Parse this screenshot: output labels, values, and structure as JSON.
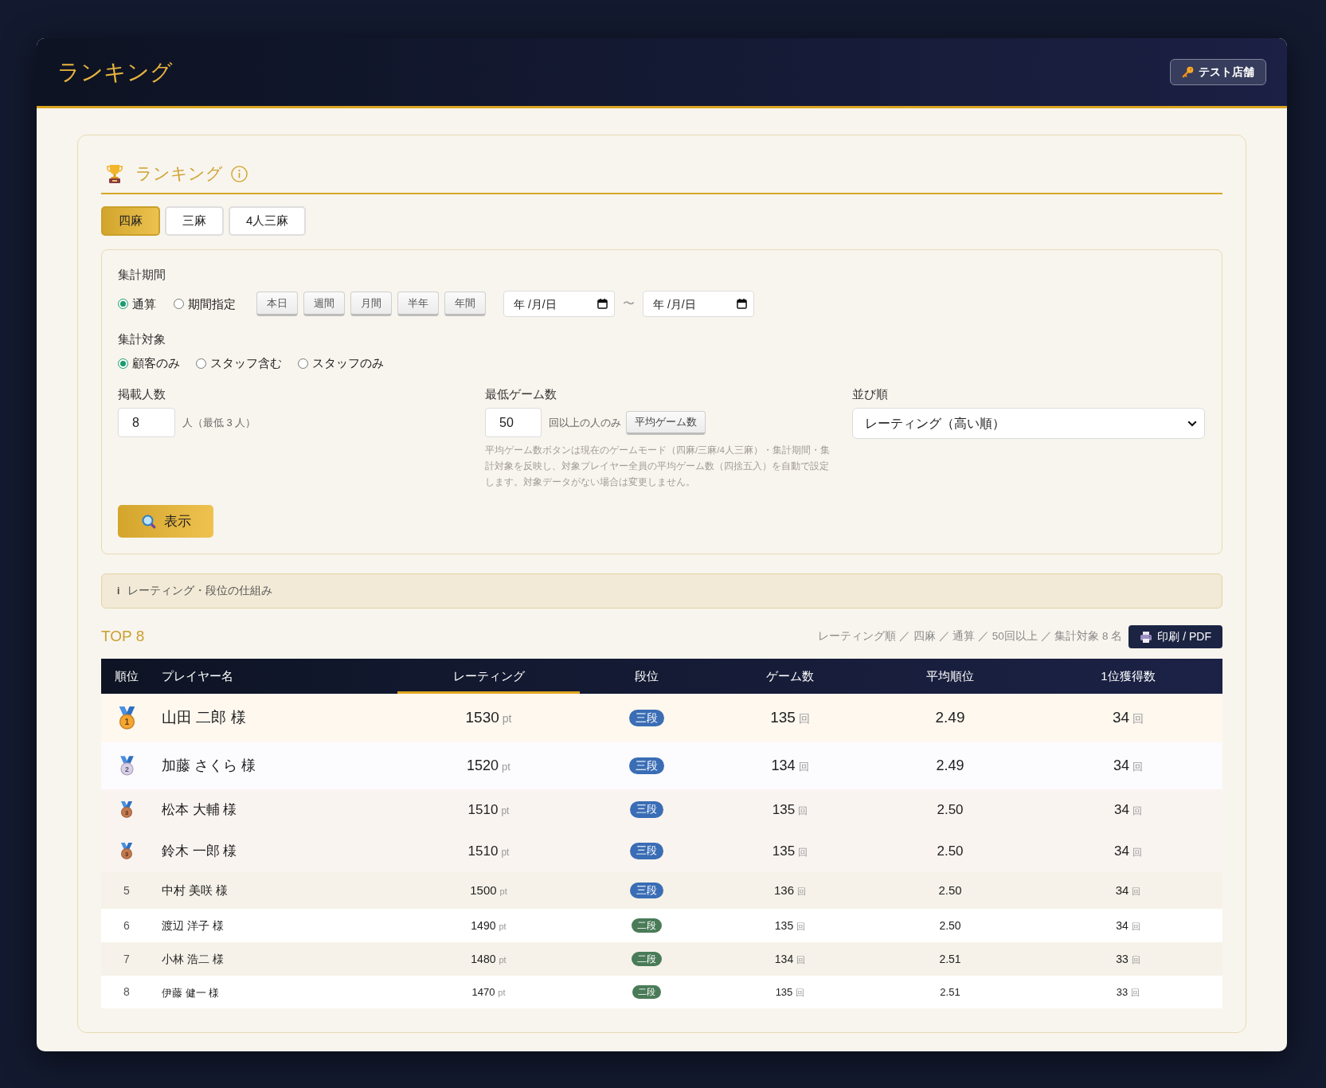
{
  "header": {
    "title": "ランキング",
    "store_button": "テスト店舗"
  },
  "section": {
    "title": "ランキング"
  },
  "tabs": [
    {
      "label": "四麻",
      "selected": true
    },
    {
      "label": "三麻",
      "selected": false
    },
    {
      "label": "4人三麻",
      "selected": false
    }
  ],
  "filters": {
    "period": {
      "label": "集計期間",
      "options": [
        {
          "label": "通算",
          "selected": true
        },
        {
          "label": "期間指定",
          "selected": false
        }
      ],
      "presets": [
        "本日",
        "週間",
        "月間",
        "半年",
        "年間"
      ],
      "date_from": {
        "placeholder": "年 /月/日"
      },
      "separator": "〜",
      "date_to": {
        "placeholder": "年 /月/日"
      }
    },
    "target": {
      "label": "集計対象",
      "options": [
        {
          "label": "顧客のみ",
          "selected": true
        },
        {
          "label": "スタッフ含む",
          "selected": false
        },
        {
          "label": "スタッフのみ",
          "selected": false
        }
      ]
    },
    "display_count": {
      "label": "掲載人数",
      "value": "8",
      "suffix": "人（最低 3 人）"
    },
    "min_games": {
      "label": "最低ゲーム数",
      "value": "50",
      "suffix": "回以上の人のみ",
      "button": "平均ゲーム数",
      "help": "平均ゲーム数ボタンは現在のゲームモード（四麻/三麻/4人三麻）・集計期間・集計対象を反映し、対象プレイヤー全員の平均ゲーム数（四捨五入）を自動で設定します。対象データがない場合は変更しません。"
    },
    "sort": {
      "label": "並び順",
      "value": "レーティング（高い順）"
    },
    "submit": "表示"
  },
  "info_bar": {
    "marker": "i",
    "label": "レーティング・段位の仕組み"
  },
  "results": {
    "title": "TOP 8",
    "summary": "レーティング順 ／ 四麻 ／ 通算 ／ 50回以上 ／ 集計対象 8 名",
    "print_button": "印刷 / PDF"
  },
  "table": {
    "columns": [
      {
        "label": "順位",
        "sorted": false
      },
      {
        "label": "プレイヤー名",
        "sorted": false
      },
      {
        "label": "レーティング",
        "sorted": true
      },
      {
        "label": "段位",
        "sorted": false
      },
      {
        "label": "ゲーム数",
        "sorted": false
      },
      {
        "label": "平均順位",
        "sorted": false
      },
      {
        "label": "1位獲得数",
        "sorted": false
      }
    ],
    "rows": [
      {
        "kind": "medal",
        "color": "#f7a531",
        "rank": "1",
        "name": "山田 二郎 様",
        "rating": "1530",
        "rating_unit": "pt",
        "grade": {
          "label": "三段",
          "color": "#3a6db5"
        },
        "games": "135",
        "games_unit": "回",
        "avg_rank": "2.49",
        "firsts": "34",
        "firsts_unit": "回"
      },
      {
        "kind": "medal",
        "color": "#d8cfe9",
        "rank": "2",
        "name": "加藤 さくら 様",
        "rating": "1520",
        "rating_unit": "pt",
        "grade": {
          "label": "三段",
          "color": "#3a6db5"
        },
        "games": "134",
        "games_unit": "回",
        "avg_rank": "2.49",
        "firsts": "34",
        "firsts_unit": "回"
      },
      {
        "kind": "medal",
        "color": "#c47a4e",
        "rank": "3",
        "name": "松本 大輔 様",
        "rating": "1510",
        "rating_unit": "pt",
        "grade": {
          "label": "三段",
          "color": "#3a6db5"
        },
        "games": "135",
        "games_unit": "回",
        "avg_rank": "2.50",
        "firsts": "34",
        "firsts_unit": "回"
      },
      {
        "kind": "medal",
        "color": "#c47a4e",
        "rank": "3",
        "name": "鈴木 一郎 様",
        "rating": "1510",
        "rating_unit": "pt",
        "grade": {
          "label": "三段",
          "color": "#3a6db5"
        },
        "games": "135",
        "games_unit": "回",
        "avg_rank": "2.50",
        "firsts": "34",
        "firsts_unit": "回"
      },
      {
        "kind": "plain",
        "rank": "5",
        "name": "中村 美咲 様",
        "rating": "1500",
        "rating_unit": "pt",
        "grade": {
          "label": "三段",
          "color": "#3a6db5"
        },
        "games": "136",
        "games_unit": "回",
        "avg_rank": "2.50",
        "firsts": "34",
        "firsts_unit": "回"
      },
      {
        "kind": "plain",
        "rank": "6",
        "name": "渡辺 洋子 様",
        "rating": "1490",
        "rating_unit": "pt",
        "grade": {
          "label": "二段",
          "color": "#4a7b58"
        },
        "games": "135",
        "games_unit": "回",
        "avg_rank": "2.50",
        "firsts": "34",
        "firsts_unit": "回"
      },
      {
        "kind": "plain",
        "rank": "7",
        "name": "小林 浩二 様",
        "rating": "1480",
        "rating_unit": "pt",
        "grade": {
          "label": "二段",
          "color": "#4a7b58"
        },
        "games": "134",
        "games_unit": "回",
        "avg_rank": "2.51",
        "firsts": "33",
        "firsts_unit": "回"
      },
      {
        "kind": "plain",
        "rank": "8",
        "name": "伊藤 健一 様",
        "rating": "1470",
        "rating_unit": "pt",
        "grade": {
          "label": "二段",
          "color": "#4a7b58"
        },
        "games": "135",
        "games_unit": "回",
        "avg_rank": "2.51",
        "firsts": "33",
        "firsts_unit": "回"
      }
    ]
  }
}
